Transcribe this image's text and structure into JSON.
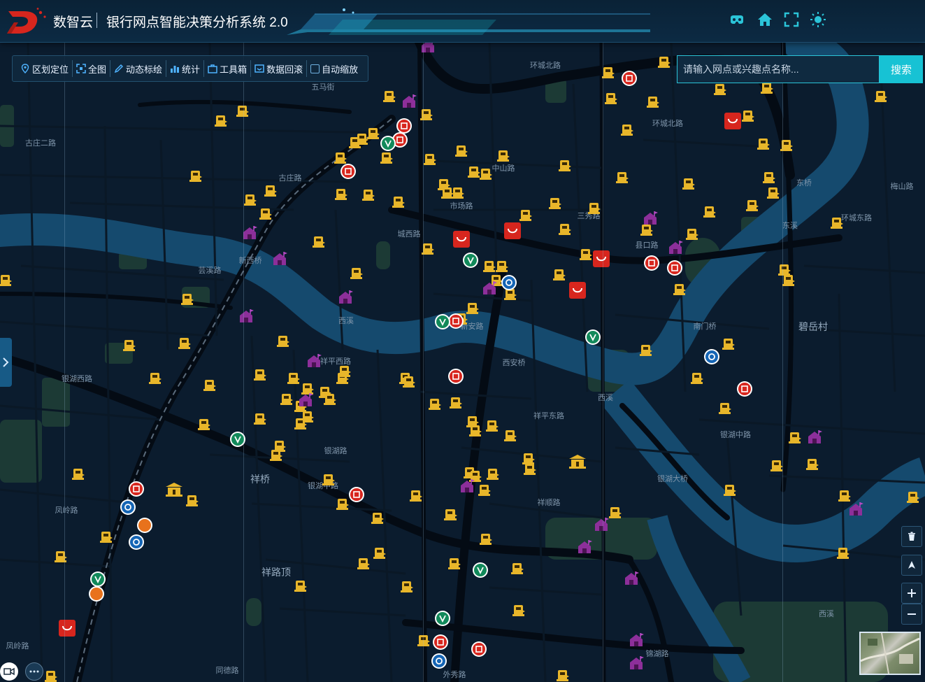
{
  "header": {
    "brand": "数智云",
    "title": "银行网点智能决策分析系统 2.0",
    "icons": [
      "vr-icon",
      "home-icon",
      "fullscreen-icon",
      "theme-sun-icon"
    ]
  },
  "toolbar": {
    "items": [
      {
        "label": "区划定位",
        "icon": "location-pin-icon"
      },
      {
        "label": "全图",
        "icon": "full-extent-icon"
      },
      {
        "label": "动态标绘",
        "icon": "pen-icon"
      },
      {
        "label": "统计",
        "icon": "stats-icon"
      },
      {
        "label": "工具箱",
        "icon": "toolbox-icon"
      },
      {
        "label": "数据回滚",
        "icon": "rollback-icon"
      },
      {
        "label": "自动缩放",
        "icon": "checkbox-icon"
      }
    ]
  },
  "search": {
    "placeholder": "请输入网点或兴趣点名称...",
    "button_label": "搜索"
  },
  "colors": {
    "accent": "#17c2d4",
    "map_bg": "#0b1c2e",
    "river": "#154a6e",
    "road": "#050d16",
    "atm_marker": "#e8b62a",
    "poi_purple": "#8d2f9a",
    "poi_red": "#d7261e"
  },
  "map": {
    "labels": [
      {
        "text": "环城北路"
      },
      {
        "text": "五马街"
      },
      {
        "text": "古庄二路"
      },
      {
        "text": "古庄路"
      },
      {
        "text": "中山路"
      },
      {
        "text": "市场路"
      },
      {
        "text": "城西路"
      },
      {
        "text": "新西桥"
      },
      {
        "text": "芸溪路"
      },
      {
        "text": "西溪"
      },
      {
        "text": "银湖西路"
      },
      {
        "text": "祥平西路"
      },
      {
        "text": "祥桥"
      },
      {
        "text": "银湖中路"
      },
      {
        "text": "祥路顶"
      },
      {
        "text": "凤岭路"
      },
      {
        "text": "西安桥"
      },
      {
        "text": "祥平东路"
      },
      {
        "text": "西溪"
      },
      {
        "text": "南门桥"
      },
      {
        "text": "碧岳村"
      },
      {
        "text": "东溪"
      },
      {
        "text": "东桥"
      },
      {
        "text": "环城东路"
      },
      {
        "text": "三秀路"
      },
      {
        "text": "县口路"
      },
      {
        "text": "银湖中路"
      },
      {
        "text": "银湖大桥"
      },
      {
        "text": "西溪"
      },
      {
        "text": "外秀路"
      },
      {
        "text": "同德路"
      },
      {
        "text": "银湖路"
      },
      {
        "text": "祥顺路"
      },
      {
        "text": "凤岭路"
      },
      {
        "text": "环城北路"
      },
      {
        "text": "新安路"
      },
      {
        "text": "锦湖路"
      },
      {
        "text": "梅山路"
      }
    ]
  },
  "controls": {
    "right": [
      "trash-icon",
      "north-arrow-icon",
      "zoom-in-icon",
      "zoom-out-icon"
    ],
    "bottom_left": [
      "video-icon",
      "more-icon"
    ]
  }
}
